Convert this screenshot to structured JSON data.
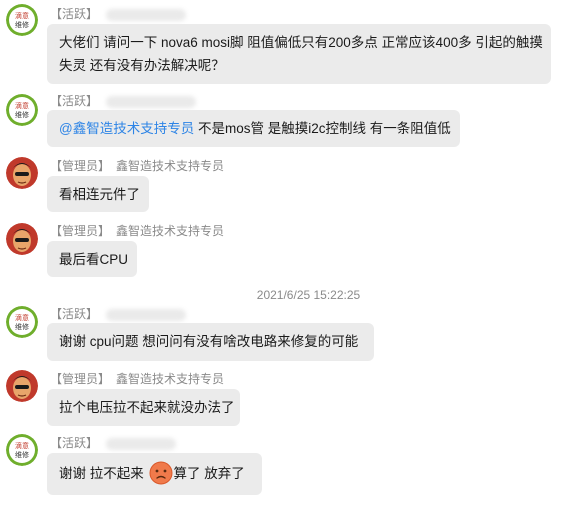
{
  "timestamp": "2021/6/25 15:22:25",
  "messages": [
    {
      "role": "【活跃】",
      "avatar": "repair-shop-logo",
      "lines": [
        "大佬们  请问一下 nova6 mosi脚 阻值偏低只有200多点 正常应该400多  引起的触摸",
        "失灵  还有没有办法解决呢？"
      ]
    },
    {
      "role": "【活跃】",
      "avatar": "repair-shop-logo",
      "mention": "@鑫智造技术支持专员",
      "text": " 不是mos管 是触摸i2c控制线 有一条阻值低"
    },
    {
      "role": "【管理员】",
      "nick": "鑫智造技术支持专员",
      "avatar": "admin-cartoon",
      "text": "看相连元件了"
    },
    {
      "role": "【管理员】",
      "nick": "鑫智造技术支持专员",
      "avatar": "admin-cartoon",
      "text": "最后看CPU"
    },
    {
      "role": "【活跃】",
      "avatar": "repair-shop-logo",
      "text": "谢谢  cpu问题  想问问有没有啥改电路来修复的可能"
    },
    {
      "role": "【管理员】",
      "nick": "鑫智造技术支持专员",
      "avatar": "admin-cartoon",
      "text": "拉个电压拉不起来就没办法了"
    },
    {
      "role": "【活跃】",
      "avatar": "repair-shop-logo",
      "text_before": "谢谢 拉不起来 ",
      "emoji": "sad-face-emoji",
      "text_after": "算了 放弃了"
    }
  ],
  "logo_text": [
    "滴意",
    "维修"
  ]
}
